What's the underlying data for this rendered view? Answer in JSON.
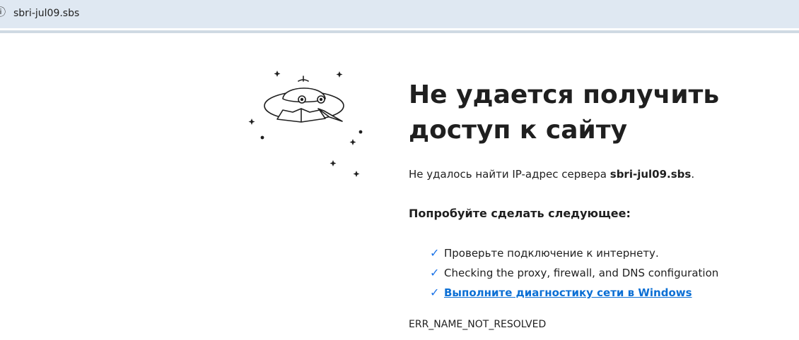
{
  "browser": {
    "url": "sbri-jul09.sbs"
  },
  "error_page": {
    "title_line1": "Не удается получить",
    "title_line2": "доступ к сайту",
    "desc_prefix": "Не удалось найти IP-адрес сервера ",
    "desc_host": "sbri-jul09.sbs",
    "desc_suffix": ".",
    "try_heading": "Попробуйте сделать следующее:",
    "suggestions": [
      "Проверьте подключение к интернету.",
      "Checking the proxy, firewall, and DNS configuration",
      "Выполните диагностику сети в Windows"
    ],
    "error_code": "ERR_NAME_NOT_RESOLVED"
  },
  "icons": {
    "check": "checkmark-icon",
    "illustration": "ufo-icon"
  },
  "colors": {
    "addressbar_bg": "#dfe8f2",
    "check": "#1a73e8",
    "link": "#0b6fd4",
    "text": "#1f1f1f"
  }
}
